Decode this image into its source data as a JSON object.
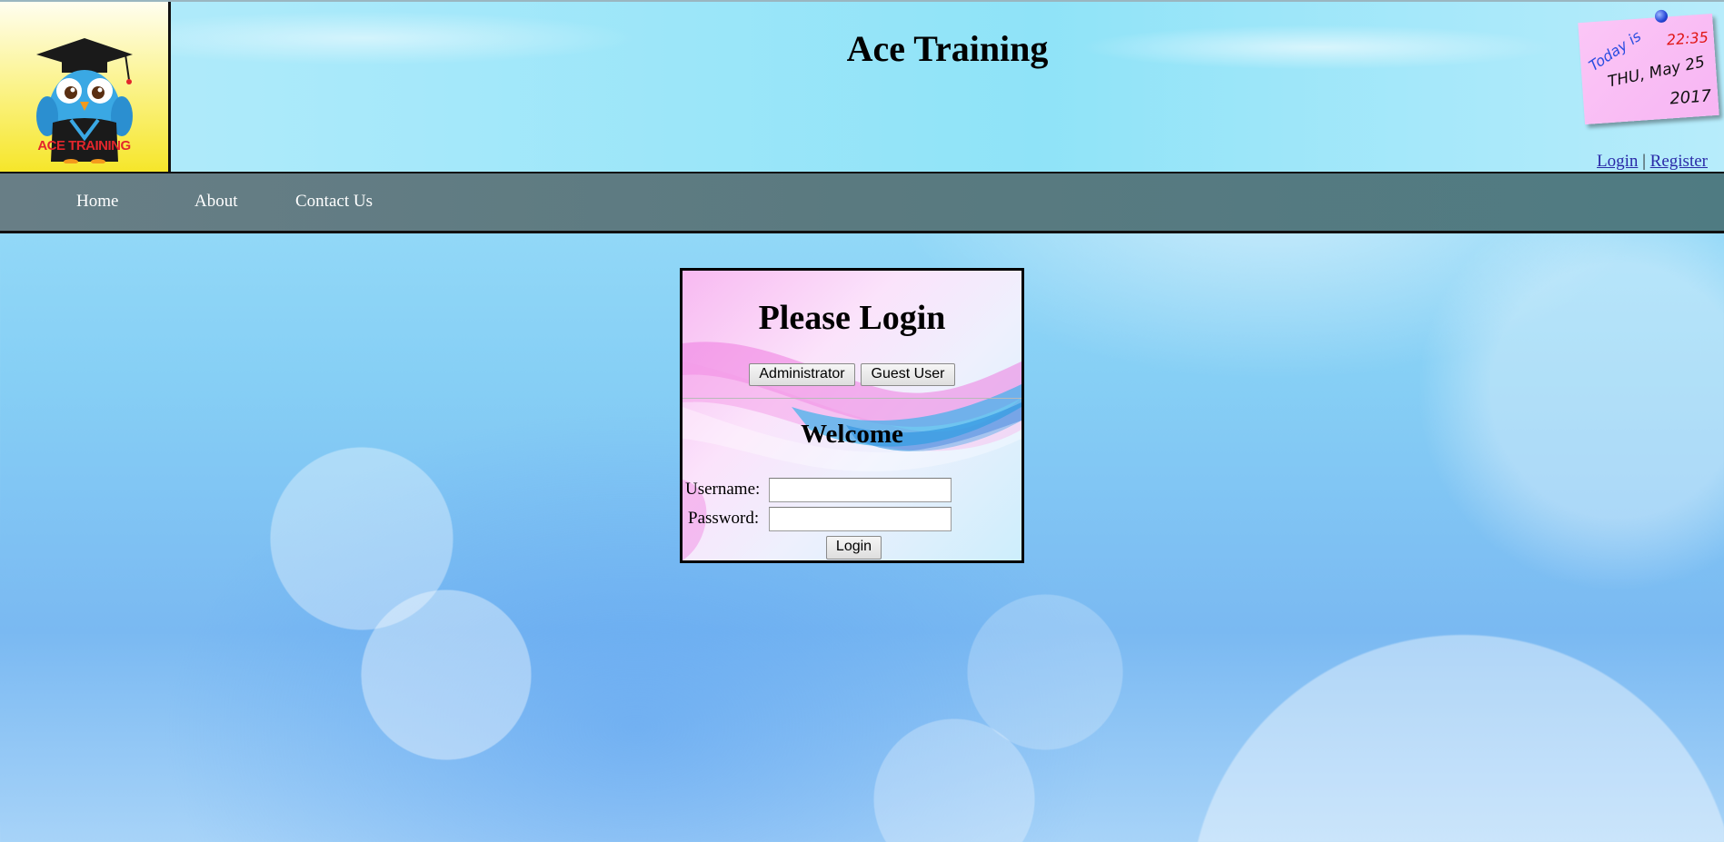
{
  "header": {
    "title": "Ace Training",
    "logo_text": "ACE TRAINING",
    "date_note": {
      "today_label": "Today is",
      "time": "22:35",
      "day": "THU, May 25",
      "year": "2017"
    },
    "auth": {
      "login_label": "Login",
      "separator": "|",
      "register_label": "Register"
    }
  },
  "nav": {
    "items": [
      {
        "label": "Home"
      },
      {
        "label": "About"
      },
      {
        "label": "Contact Us"
      }
    ]
  },
  "login_panel": {
    "title": "Please Login",
    "role_buttons": [
      {
        "label": "Administrator"
      },
      {
        "label": "Guest User"
      }
    ],
    "welcome": "Welcome",
    "username_label": "Username:",
    "username_value": "",
    "password_label": "Password:",
    "password_value": "",
    "submit_label": "Login"
  },
  "colors": {
    "navbar": "#5a7a80",
    "link": "#2a2aa8",
    "logo_text": "#e2262c",
    "note_time": "#e01515",
    "note_today": "#2a4de0"
  }
}
